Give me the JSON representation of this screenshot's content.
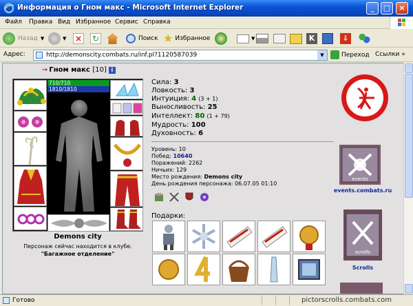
{
  "window": {
    "title": "Информация о Гном макс - Microsoft Internet Explorer",
    "min": "_",
    "max": "□",
    "close": "×"
  },
  "menu": [
    "Файл",
    "Правка",
    "Вид",
    "Избранное",
    "Сервис",
    "Справка"
  ],
  "toolbar": {
    "back": "Назад",
    "search": "Поиск",
    "favorites": "Избранное"
  },
  "address": {
    "label": "Адрес:",
    "url": "http://demonscity.combats.ru/inf.pl?1120587039",
    "go": "Переход",
    "links": "Ссылки »"
  },
  "character": {
    "name": "Гном макс",
    "level": "[10]",
    "hp": "710/710",
    "mana": "1810/1810",
    "city": "Demons city",
    "location_text": "Персонаж сейчас находится в клубе.",
    "location_room": "\"Багажное отделение\""
  },
  "stats": [
    {
      "label": "Сила:",
      "value": "3",
      "extra": ""
    },
    {
      "label": "Ловкость:",
      "value": "3",
      "extra": ""
    },
    {
      "label": "Интуиция:",
      "value": "4",
      "extra": "(3 + 1)"
    },
    {
      "label": "Выносливость:",
      "value": "25",
      "extra": ""
    },
    {
      "label": "Интеллект:",
      "value": "80",
      "extra": "(1 + 79)"
    },
    {
      "label": "Мудрость:",
      "value": "100",
      "extra": ""
    },
    {
      "label": "Духовность:",
      "value": "6",
      "extra": ""
    }
  ],
  "info": [
    {
      "label": "Уровень:",
      "value": "10"
    },
    {
      "label": "Побед:",
      "value": "10640"
    },
    {
      "label": "Поражений:",
      "value": "2262"
    },
    {
      "label": "Ничьих:",
      "value": "129"
    },
    {
      "label": "Место рождения:",
      "value": "Demons city"
    },
    {
      "label": "День рождения персонажа:",
      "value": "06.07.05 01:10"
    }
  ],
  "gifts_label": "Подарки:",
  "banners": {
    "events": "events.combats.ru",
    "events_inner": "events",
    "scrolls": "Scrolls",
    "scrolls_inner": "scrolls"
  },
  "status": {
    "text": "Готово",
    "site": "pictorscrolls.combats.com"
  },
  "colors": {
    "hp": "#0a9a22",
    "mana": "#1c39a8",
    "titlebar": "#0a55d6",
    "page_bg": "#e2e0e0"
  }
}
